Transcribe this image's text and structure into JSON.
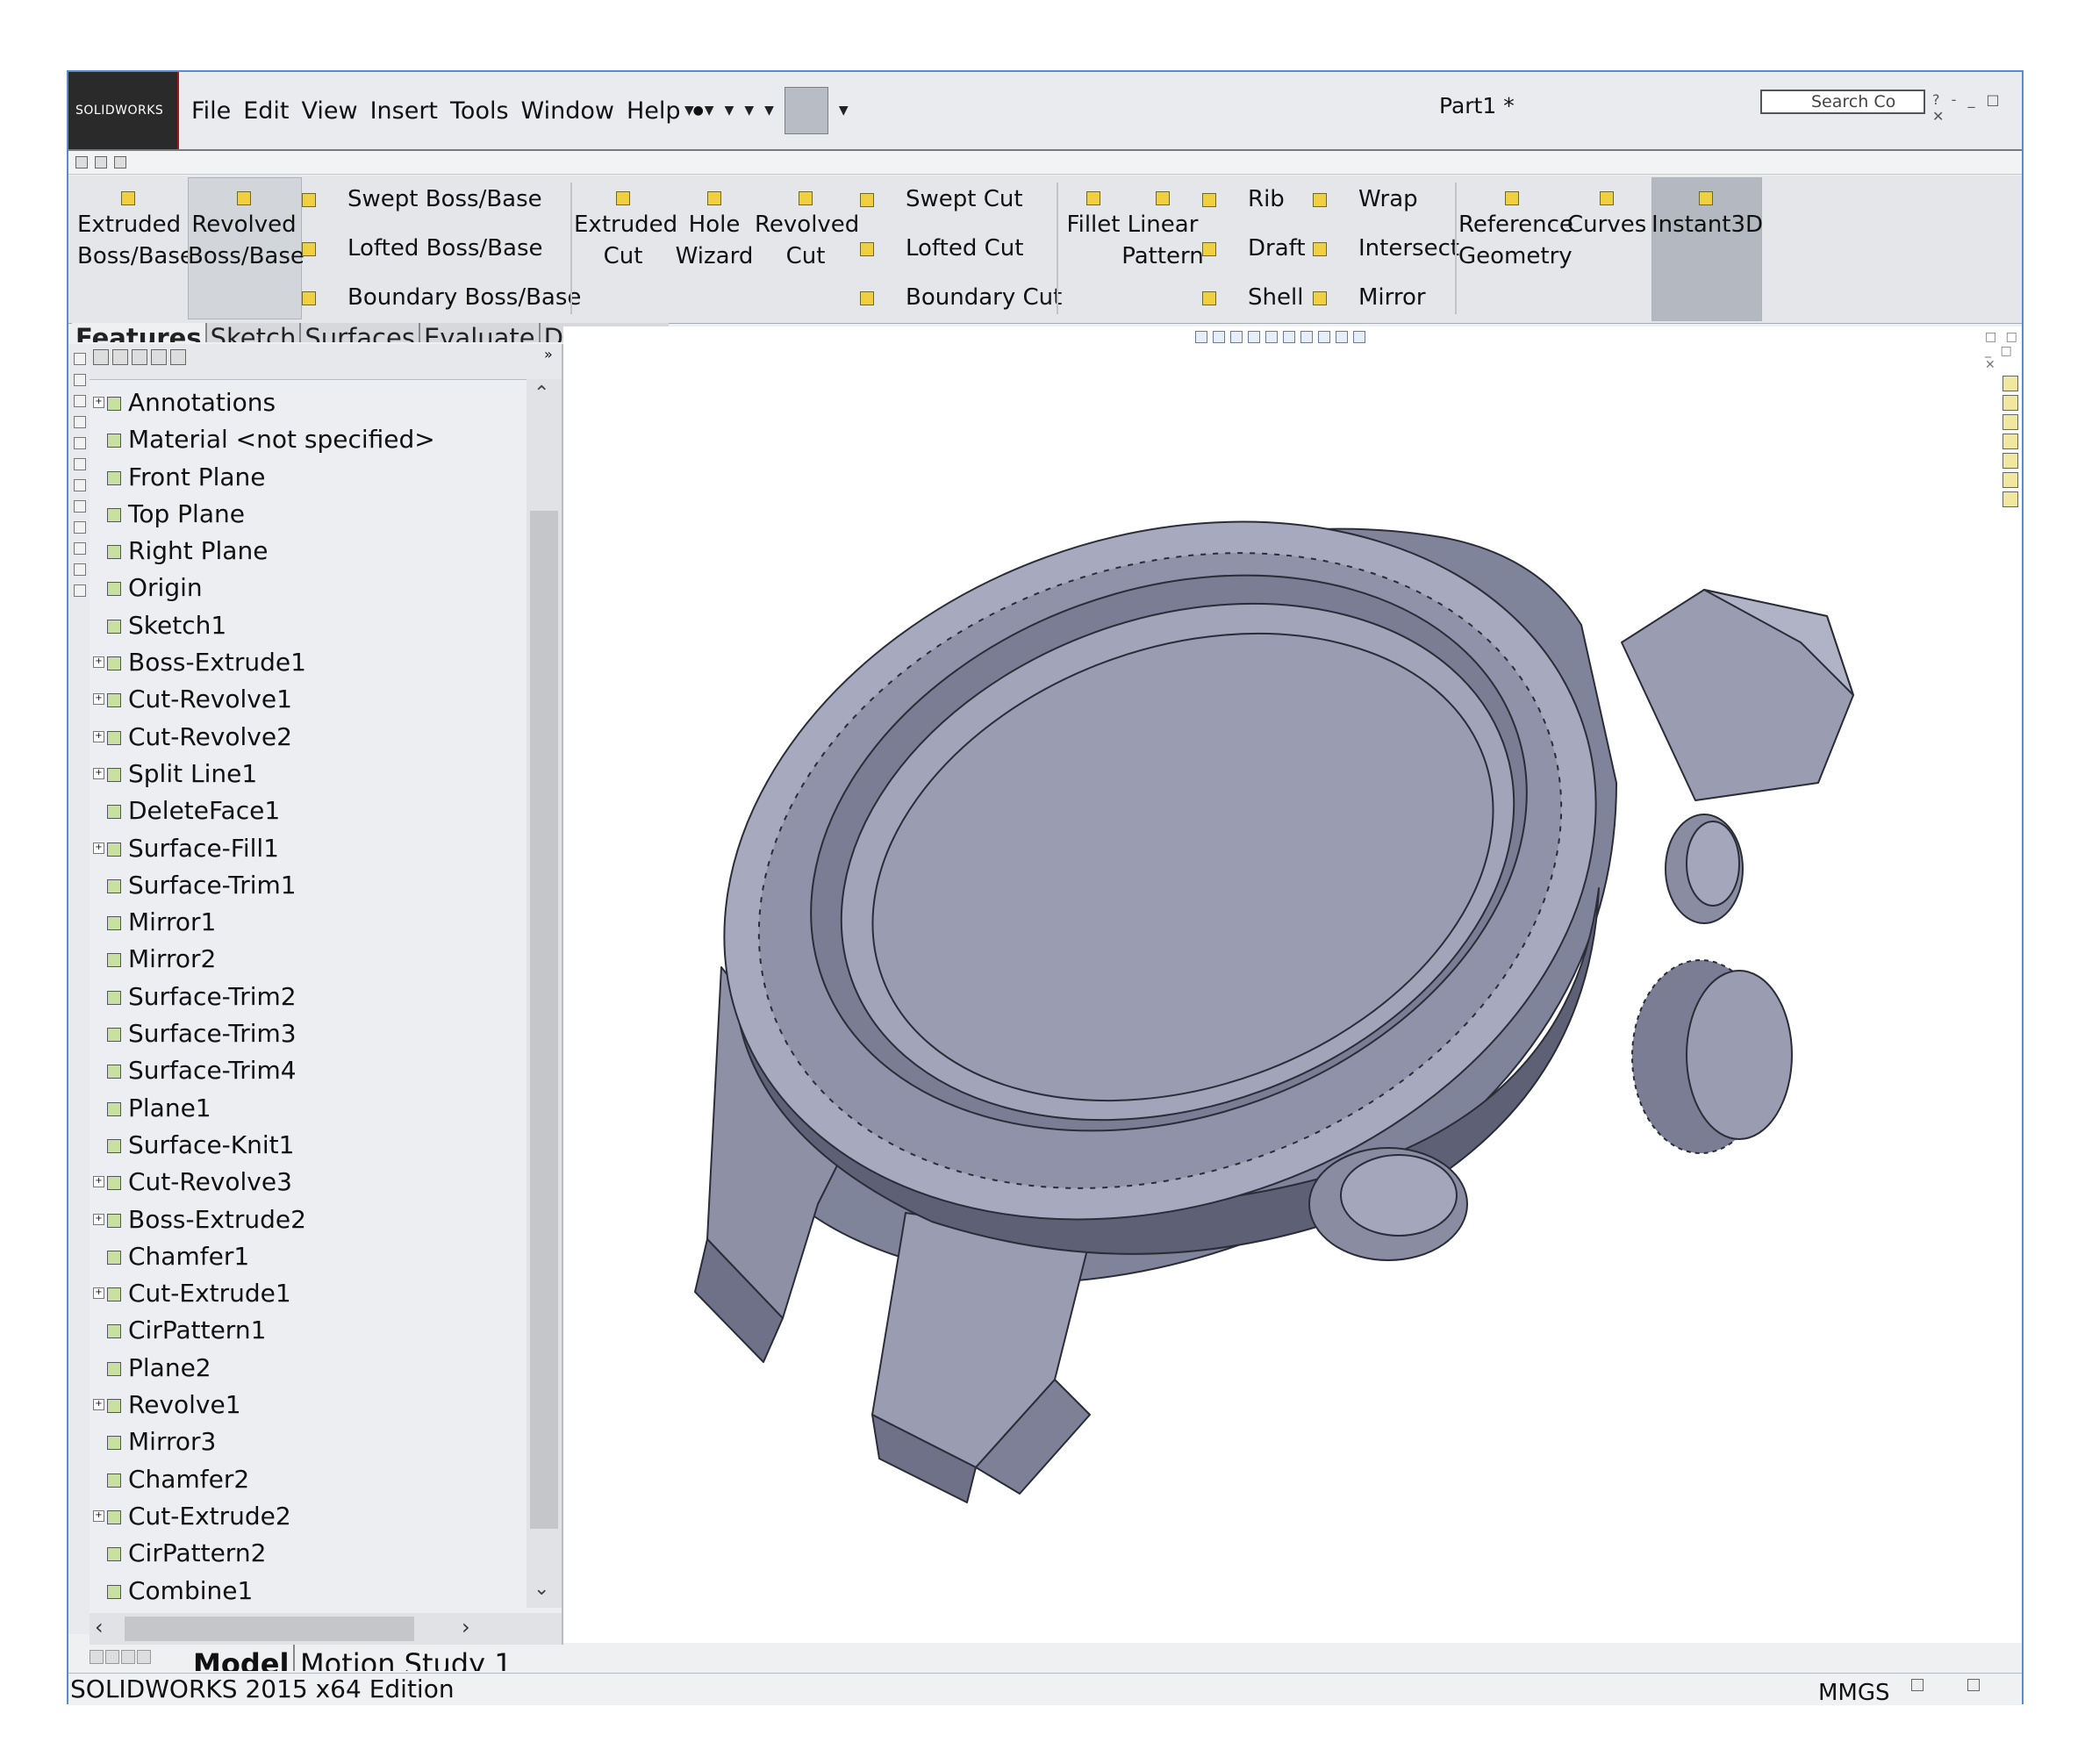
{
  "app": {
    "brand": "SOLIDWORKS",
    "document_title": "Part1 *"
  },
  "menu": [
    {
      "name": "menu-file",
      "label": "File"
    },
    {
      "name": "menu-edit",
      "label": "Edit"
    },
    {
      "name": "menu-view",
      "label": "View"
    },
    {
      "name": "menu-insert",
      "label": "Insert"
    },
    {
      "name": "menu-tools",
      "label": "Tools"
    },
    {
      "name": "menu-window",
      "label": "Window"
    },
    {
      "name": "menu-help",
      "label": "Help"
    }
  ],
  "search": {
    "placeholder": "Search Co"
  },
  "commands": {
    "extruded_boss": [
      "Extruded",
      "Boss/Base"
    ],
    "revolved_boss": [
      "Revolved",
      "Boss/Base"
    ],
    "swept_boss": "Swept Boss/Base",
    "lofted_boss": "Lofted Boss/Base",
    "boundary_boss": "Boundary Boss/Base",
    "extruded_cut": [
      "Extruded",
      "Cut"
    ],
    "hole_wizard": [
      "Hole",
      "Wizard"
    ],
    "revolved_cut": [
      "Revolved",
      "Cut"
    ],
    "swept_cut": "Swept Cut",
    "lofted_cut": "Lofted Cut",
    "boundary_cut": "Boundary Cut",
    "fillet": "Fillet",
    "linear_pattern": [
      "Linear",
      "Pattern"
    ],
    "rib": "Rib",
    "draft": "Draft",
    "shell": "Shell",
    "wrap": "Wrap",
    "intersect": "Intersect",
    "mirror": "Mirror",
    "reference_geometry": [
      "Reference",
      "Geometry"
    ],
    "curves": "Curves",
    "instant3d": "Instant3D"
  },
  "tabs": [
    "Features",
    "Sketch",
    "Surfaces",
    "Evaluate",
    "DimXpert"
  ],
  "tree": [
    {
      "label": "Annotations",
      "expandable": true
    },
    {
      "label": "Material <not specified>",
      "expandable": false
    },
    {
      "label": "Front Plane",
      "expandable": false
    },
    {
      "label": "Top Plane",
      "expandable": false
    },
    {
      "label": "Right Plane",
      "expandable": false
    },
    {
      "label": "Origin",
      "expandable": false
    },
    {
      "label": "Sketch1",
      "expandable": false
    },
    {
      "label": "Boss-Extrude1",
      "expandable": true
    },
    {
      "label": "Cut-Revolve1",
      "expandable": true
    },
    {
      "label": "Cut-Revolve2",
      "expandable": true
    },
    {
      "label": "Split Line1",
      "expandable": true
    },
    {
      "label": "DeleteFace1",
      "expandable": false
    },
    {
      "label": "Surface-Fill1",
      "expandable": true
    },
    {
      "label": "Surface-Trim1",
      "expandable": false
    },
    {
      "label": "Mirror1",
      "expandable": false
    },
    {
      "label": "Mirror2",
      "expandable": false
    },
    {
      "label": "Surface-Trim2",
      "expandable": false
    },
    {
      "label": "Surface-Trim3",
      "expandable": false
    },
    {
      "label": "Surface-Trim4",
      "expandable": false
    },
    {
      "label": "Plane1",
      "expandable": false
    },
    {
      "label": "Surface-Knit1",
      "expandable": false
    },
    {
      "label": "Cut-Revolve3",
      "expandable": true
    },
    {
      "label": "Boss-Extrude2",
      "expandable": true
    },
    {
      "label": "Chamfer1",
      "expandable": false
    },
    {
      "label": "Cut-Extrude1",
      "expandable": true
    },
    {
      "label": "CirPattern1",
      "expandable": false
    },
    {
      "label": "Plane2",
      "expandable": false
    },
    {
      "label": "Revolve1",
      "expandable": true
    },
    {
      "label": "Mirror3",
      "expandable": false
    },
    {
      "label": "Chamfer2",
      "expandable": false
    },
    {
      "label": "Cut-Extrude2",
      "expandable": true
    },
    {
      "label": "CirPattern2",
      "expandable": false
    },
    {
      "label": "Combine1",
      "expandable": false
    }
  ],
  "bottom_tabs": {
    "model": "Model",
    "motion": "Motion Study 1"
  },
  "status": {
    "edition": "SOLIDWORKS 2015 x64 Edition",
    "units": "MMGS"
  },
  "colors": {
    "model_fill": "#9a9db2",
    "model_dark": "#6e7188",
    "model_light": "#b8bbcc",
    "brand_red": "#a01818"
  }
}
